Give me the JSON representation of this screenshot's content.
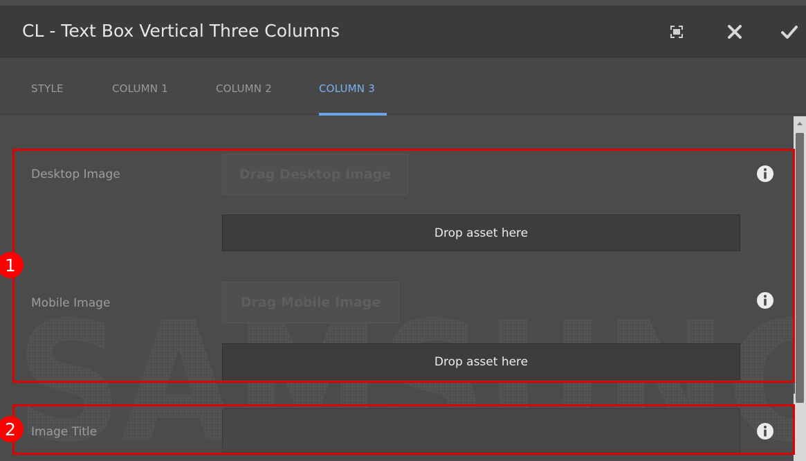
{
  "dialog": {
    "title": "CL - Text Box Vertical Three Columns",
    "icons": [
      "fullscreen-icon",
      "close-icon",
      "checkmark-icon"
    ]
  },
  "tabs": [
    {
      "label": "STYLE",
      "active": false
    },
    {
      "label": "COLUMN 1",
      "active": false
    },
    {
      "label": "COLUMN 2",
      "active": false
    },
    {
      "label": "COLUMN 3",
      "active": true
    }
  ],
  "fields": {
    "desktop_image": {
      "label": "Desktop Image",
      "drag_label": "Drag Desktop Image",
      "drop_label": "Drop asset here"
    },
    "mobile_image": {
      "label": "Mobile Image",
      "drag_label": "Drag Mobile Image",
      "drop_label": "Drop asset here"
    },
    "image_title": {
      "label": "Image Title",
      "value": ""
    }
  },
  "annotations": {
    "marker_1": "1",
    "marker_2": "2"
  },
  "watermark_text": "SAMSUNG",
  "colors": {
    "accent": "#6aa6e8",
    "highlight": "#e00000",
    "background": "#4b4b4b"
  }
}
